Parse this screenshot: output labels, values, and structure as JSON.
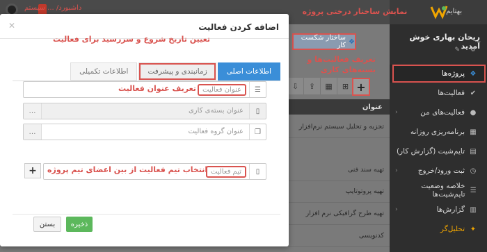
{
  "topbar": {
    "logo_text": "بهتایم",
    "left_title": "داشبورد/ ... سیستم"
  },
  "user": {
    "name": "ریحان بهاری خوش آمدید"
  },
  "sidebar": {
    "items": [
      {
        "label": "پروژه‌ها",
        "icon": "sitemap-icon"
      },
      {
        "label": "فعالیت‌ها",
        "icon": "check-icon"
      },
      {
        "label": "فعالیت‌های من",
        "icon": "user-icon"
      },
      {
        "label": "برنامه‌ریزی روزانه",
        "icon": "calendar-icon"
      },
      {
        "label": "تایم‌شیت (گزارش کار)",
        "icon": "table-icon"
      },
      {
        "label": "ثبت ورود/خروج",
        "icon": "clock-icon"
      },
      {
        "label": "خلاصه وضعیت تایم‌شیت‌ها",
        "icon": "list-icon"
      },
      {
        "label": "گزارش‌ها",
        "icon": "chart-icon"
      },
      {
        "label": "تحلیل‌گر",
        "icon": "wand-icon"
      }
    ]
  },
  "main": {
    "wbs_button": "ساختار شکست کار",
    "grid_header": "عنوان",
    "rows": [
      "تجزیه و تحلیل سیستم نرم‌افزار",
      "تهیه سند فنی",
      "تهیه پروتوتایپ",
      "تهیه طرح گرافیکی نرم افزار",
      "کدنویسی"
    ]
  },
  "modal": {
    "title": "اضافه کردن فعالیت",
    "tabs": [
      "اطلاعات اصلی",
      "زمانبندی و پیشرفت",
      "اطلاعات تکمیلی"
    ],
    "fields": {
      "activity_title": "عنوان فعالیت",
      "work_package": "عنوان بسته‌ی کاری",
      "activity_group": "عنوان گروه فعالیت",
      "activity_team": "تیم فعالیت"
    },
    "save": "ذخیره",
    "close": "بستن"
  },
  "annotations": {
    "wbs": "نمایش ساختار درختی پروژه",
    "define": "تعریف فعالیت‌ها و بسته‌های کاری",
    "schedule": "تعیین تاریخ شروع و سررسید برای فعالیت",
    "title_def": "تعریف عنوان فعالیت",
    "team": "انتخاب تیم فعالیت از بین اعضای تیم پروژه"
  },
  "colors": {
    "accent": "#3a8ed8",
    "annotation": "#d9534f",
    "save": "#5cb85c"
  }
}
